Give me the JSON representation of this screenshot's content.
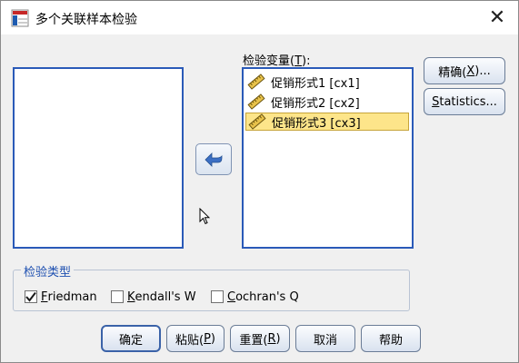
{
  "window": {
    "title": "多个关联样本检验",
    "close_glyph": "✕"
  },
  "test_variables": {
    "label_prefix": "检验变量(",
    "label_mnemonic": "T",
    "label_suffix": "):",
    "items": [
      {
        "label": "促销形式1 [cx1]",
        "selected": false
      },
      {
        "label": "促销形式2 [cx2]",
        "selected": false
      },
      {
        "label": "促销形式3 [cx3]",
        "selected": true
      }
    ]
  },
  "side_buttons": {
    "exact_prefix": "精确(",
    "exact_mnemonic": "X",
    "exact_suffix": ")...",
    "statistics_mnemonic": "S",
    "statistics_rest": "tatistics..."
  },
  "test_type": {
    "legend": "检验类型",
    "options": [
      {
        "mnemonic": "F",
        "rest": "riedman",
        "checked": true
      },
      {
        "mnemonic": "K",
        "rest": "endall's W",
        "checked": false
      },
      {
        "mnemonic": "C",
        "rest": "ochran's Q",
        "checked": false
      }
    ]
  },
  "footer_buttons": {
    "ok": "确定",
    "paste_prefix": "粘贴(",
    "paste_mnemonic": "P",
    "paste_suffix": ")",
    "reset_prefix": "重置(",
    "reset_mnemonic": "R",
    "reset_suffix": ")",
    "cancel": "取消",
    "help": "帮助"
  },
  "colors": {
    "listbox_border": "#2a5ab8",
    "selection_bg": "#fde58a",
    "legend_text": "#1d4fb0",
    "arrow_fill": "#3b6fc4"
  },
  "icons": {
    "app": "spss-dialog-icon",
    "variable": "scale-ruler-icon",
    "move": "left-arrow-icon"
  }
}
